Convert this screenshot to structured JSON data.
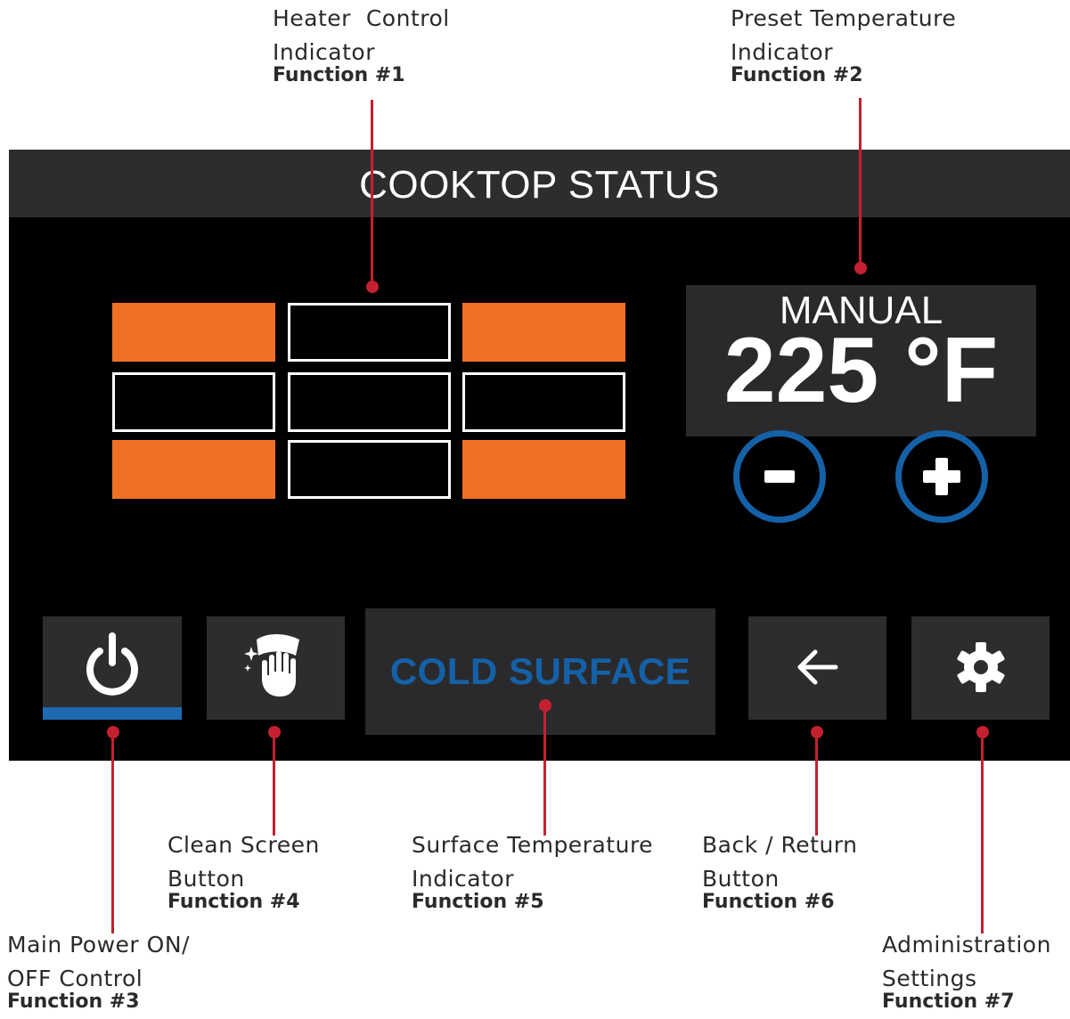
{
  "screen": {
    "title": "COOKTOP STATUS",
    "colors": {
      "header_bg": "#2d2d2f",
      "screen_bg": "#000000",
      "heater_on": "#f07125",
      "heater_off_outline": "#ffffff",
      "accent_blue": "#1561a8",
      "leader_red": "#c5202f"
    },
    "heater_grid": {
      "rows": [
        [
          "on",
          "off",
          "on"
        ],
        [
          "off",
          "off",
          "off"
        ],
        [
          "on",
          "off",
          "on"
        ]
      ]
    },
    "preset": {
      "mode": "MANUAL",
      "temperature": "225 °F",
      "decrease_symbol": "-",
      "increase_symbol": "+"
    },
    "buttons": {
      "power": {
        "icon": "power-icon",
        "active_indicator": true
      },
      "clean_screen": {
        "icon": "clean-hand-icon"
      },
      "back": {
        "icon": "arrow-left-icon"
      },
      "settings": {
        "icon": "gear-icon"
      }
    },
    "surface_status": "COLD SURFACE"
  },
  "callouts": {
    "heater_control": {
      "line1": "Heater  Control",
      "line2": "Indicator",
      "function": "Function #1"
    },
    "preset_temperature": {
      "line1": "Preset Temperature",
      "line2": "Indicator",
      "function": "Function #2"
    },
    "main_power": {
      "line1": "Main Power ON/",
      "line2": "OFF Control",
      "function": "Function #3"
    },
    "clean_screen": {
      "line1": "Clean Screen",
      "line2": "Button",
      "function": "Function #4"
    },
    "surface_temperature": {
      "line1": "Surface Temperature",
      "line2": "Indicator",
      "function": "Function #5"
    },
    "back_return": {
      "line1": "Back / Return",
      "line2": "Button",
      "function": "Function #6"
    },
    "administration": {
      "line1": "Administration",
      "line2": "Settings",
      "function": "Function #7"
    }
  }
}
